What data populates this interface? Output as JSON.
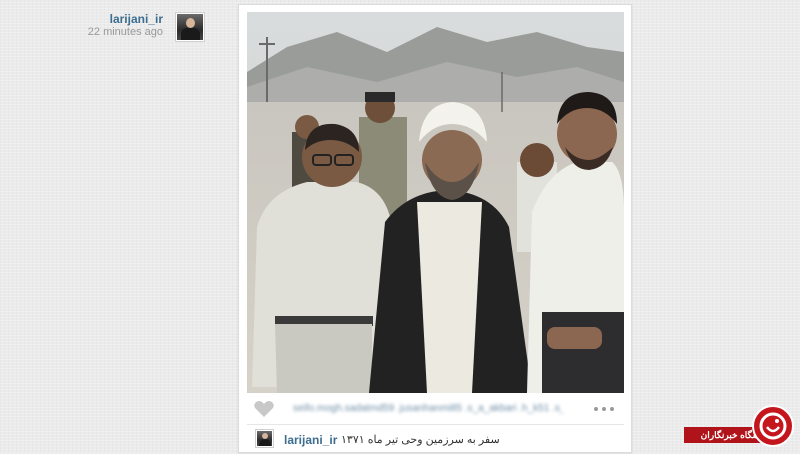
{
  "author": {
    "username": "larijani_ir",
    "time": "22 minutes ago"
  },
  "post": {
    "likes_text": "seifo.mogh.sadatmd59 .jusanhanmi85 .s_a_akbari .h_k51 .s_h...",
    "caption_user": "larijani_ir",
    "caption_text": "سفر به سرزمین وحی تیر ماه ۱۳۷۱"
  },
  "watermark": {
    "label": "باشگاه خبرنگاران"
  },
  "icons": [
    "heart-icon",
    "more-options-icon",
    "avatar-image",
    "watermark-logo"
  ],
  "colors": {
    "username": "#3d6d8f",
    "time": "#999999",
    "watermark_red": "#c4161c"
  }
}
